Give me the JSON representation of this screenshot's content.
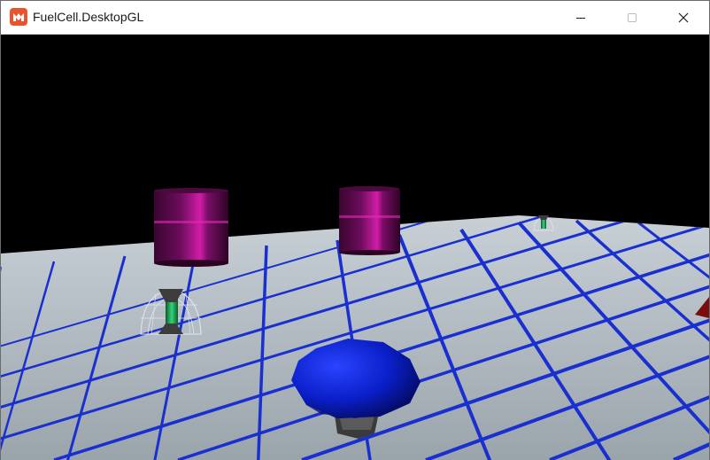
{
  "window": {
    "title": "FuelCell.DesktopGL",
    "icon": "monogame-logo-icon",
    "accent_color": "#e7542e"
  },
  "controls": {
    "minimize_icon": "minimize-icon",
    "maximize_icon": "maximize-icon",
    "close_icon": "close-icon"
  },
  "scene": {
    "sky_color": "#000000",
    "floor_color": "#a9b3bb",
    "grid_color": "#1a2fd0",
    "barrel_color": "#b2168f",
    "player_color": "#0a1fd6",
    "fuel_cell_color": "#1c9b4e",
    "rock_color": "#8a1212"
  }
}
